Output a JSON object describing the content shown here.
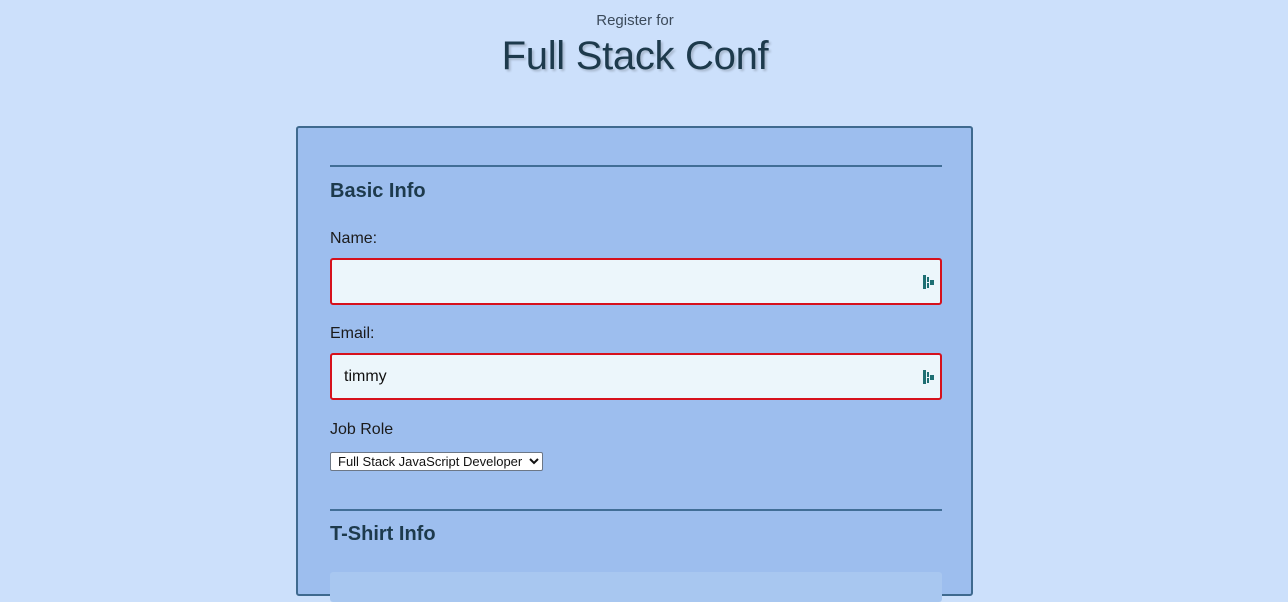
{
  "header": {
    "subtitle": "Register for",
    "title": "Full Stack Conf"
  },
  "form": {
    "basic_info": {
      "heading": "Basic Info",
      "name": {
        "label": "Name:",
        "value": ""
      },
      "email": {
        "label": "Email:",
        "value": "timmy"
      },
      "job_role": {
        "label": "Job Role",
        "selected": "Full Stack JavaScript Developer"
      }
    },
    "tshirt_info": {
      "heading": "T-Shirt Info"
    }
  },
  "colors": {
    "page_background": "#cce0fb",
    "card_background": "#9dbeee",
    "invalid_border": "#d6111c",
    "heading": "#1d3a4c",
    "autofill_icon": "#1e6f73"
  },
  "icons": {
    "input_autofill": "autofill-key-icon"
  }
}
